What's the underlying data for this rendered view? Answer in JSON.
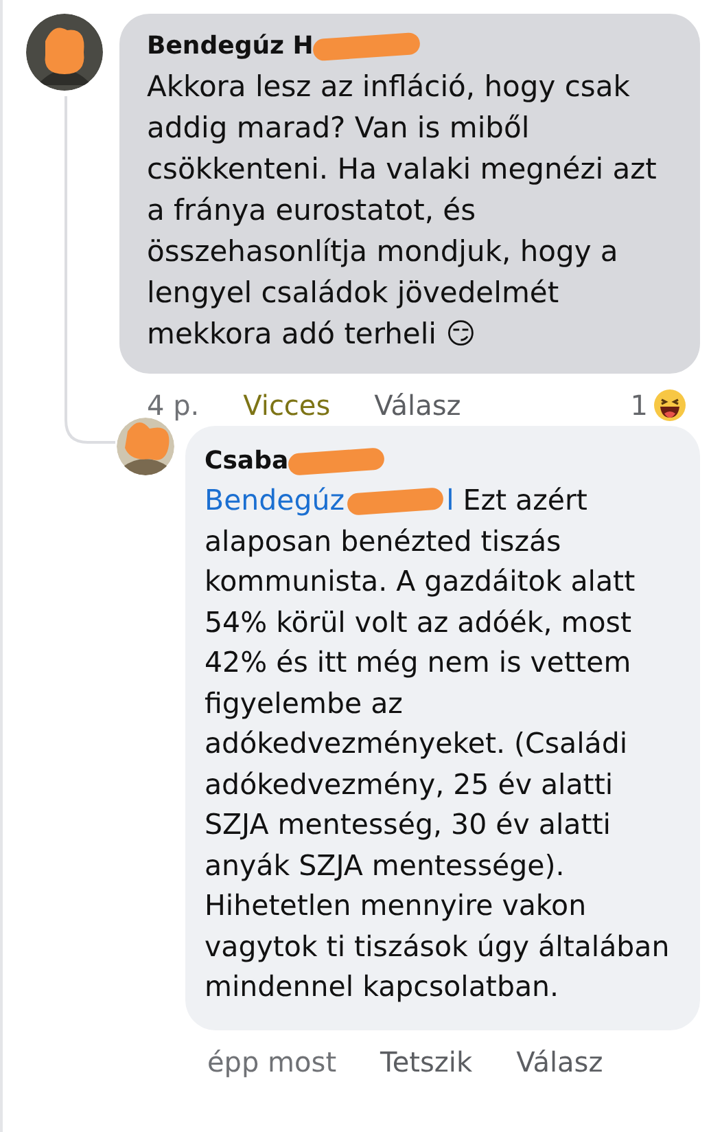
{
  "comment": {
    "author": "Bendegúz H",
    "text": "Akkora lesz az infláció, hogy csak addig marad? Van is miből csökkenteni. Ha valaki megnézi azt a fránya eurostatot, és összehasonlítja mondjuk, hogy a lengyel családok jövedelmét mekkora adó terheli 😏",
    "actions": [
      {
        "label": "4 p.",
        "kind": "time"
      },
      {
        "label": "Vicces",
        "kind": "reaction",
        "selected": true
      },
      {
        "label": "Válasz",
        "kind": "link"
      }
    ],
    "reaction_count": "1"
  },
  "reply": {
    "author": "Csaba",
    "mention": "Bendegúz",
    "mention_end": "l",
    "text": "Ezt azért alaposan benézted tiszás kommunista. A gazdáitok alatt 54% körül volt az adóék, most 42% és itt még nem is vettem figyelembe az adókedvezményeket. (Családi adókedvezmény, 25 év alatti SZJA mentesség, 30 év alatti anyák SZJA mentessége). Hihetetlen mennyire vakon vagytok ti tiszások úgy általában mindennel kapcsolatban.",
    "actions": [
      {
        "label": "épp most",
        "kind": "time"
      },
      {
        "label": "Tetszik",
        "kind": "reaction",
        "selected": false
      },
      {
        "label": "Válasz",
        "kind": "link"
      }
    ]
  }
}
